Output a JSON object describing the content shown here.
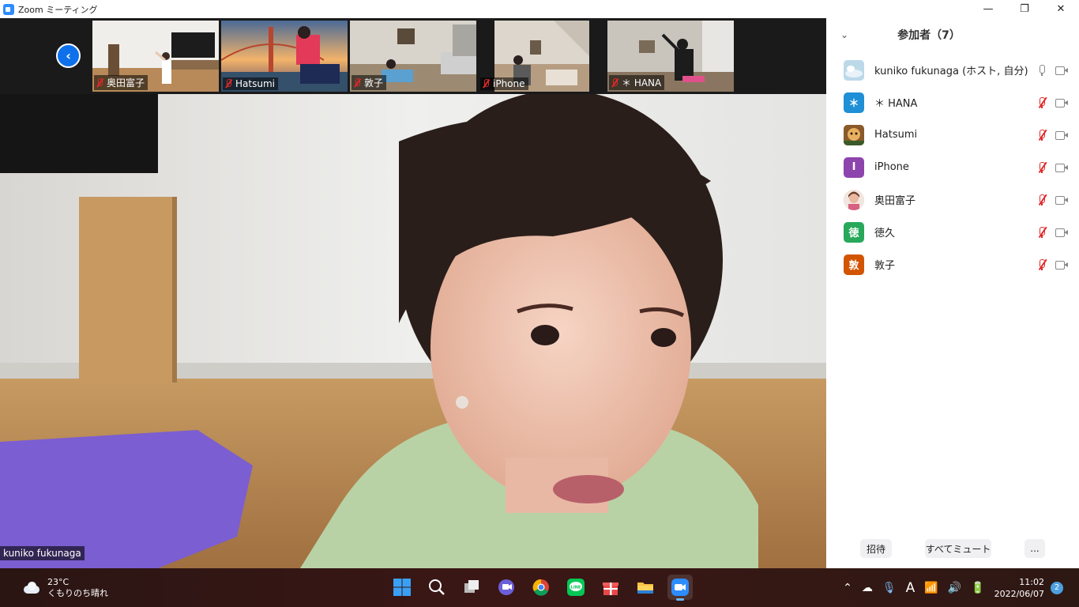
{
  "window": {
    "title": "Zoom ミーティング"
  },
  "gallery": {
    "prev_label": "‹",
    "thumbs": [
      {
        "name": "奥田富子"
      },
      {
        "name": "Hatsumi"
      },
      {
        "name": "敦子"
      },
      {
        "name": "iPhone"
      },
      {
        "name": "＊ HANA"
      }
    ]
  },
  "main_video": {
    "name": "kuniko fukunaga"
  },
  "participants": {
    "title": "参加者（7）",
    "items": [
      {
        "name": "kuniko fukunaga (ホスト, 自分)",
        "avatar_letter": "",
        "avatar_color": "#a8d0e8",
        "mic": "on"
      },
      {
        "name": "＊ HANA",
        "avatar_letter": "＊",
        "avatar_color": "#1f8fd6",
        "mic": "muted"
      },
      {
        "name": "Hatsumi",
        "avatar_letter": "",
        "avatar_color": "#c58a3a",
        "mic": "muted"
      },
      {
        "name": "iPhone",
        "avatar_letter": "I",
        "avatar_color": "#8e44ad",
        "mic": "muted"
      },
      {
        "name": "奥田富子",
        "avatar_letter": "",
        "avatar_color": "#d9a38a",
        "mic": "muted"
      },
      {
        "name": "徳久",
        "avatar_letter": "徳",
        "avatar_color": "#27a85a",
        "mic": "muted"
      },
      {
        "name": "敦子",
        "avatar_letter": "敦",
        "avatar_color": "#d35400",
        "mic": "muted"
      }
    ],
    "buttons": {
      "invite": "招待",
      "mute_all": "すべてミュート",
      "more": "..."
    }
  },
  "taskbar": {
    "weather_temp": "23°C",
    "weather_desc": "くもりのち晴れ",
    "time": "11:02",
    "date": "2022/06/07",
    "notifications": "2",
    "ime": "A"
  }
}
